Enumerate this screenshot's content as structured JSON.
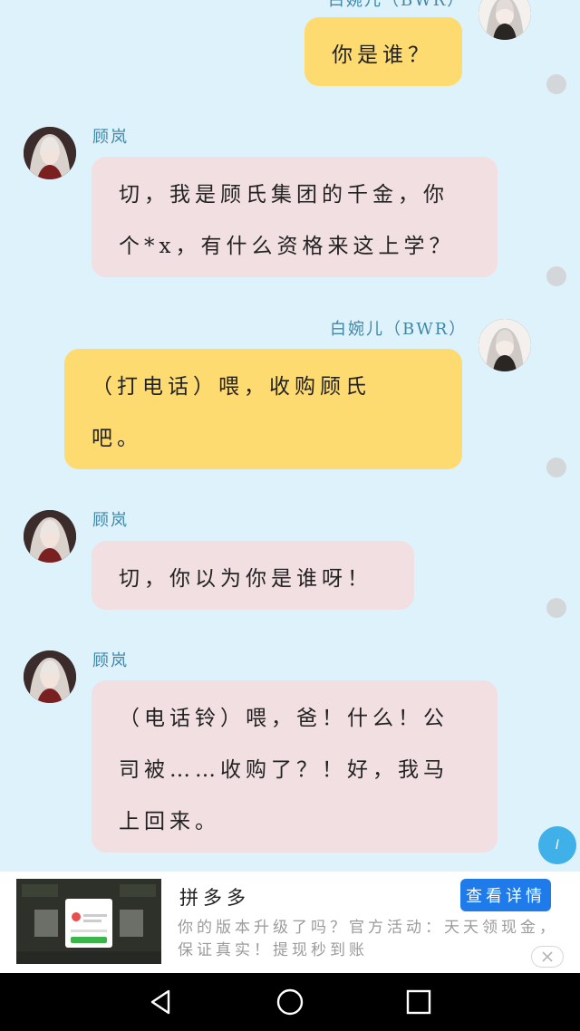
{
  "messages": [
    {
      "side": "right",
      "name": "白婉儿（BWR）",
      "text": "你是谁？"
    },
    {
      "side": "left",
      "name": "顾岚",
      "text": "切，我是顾氏集团的千金，你个*x，有什么资格来这上学？"
    },
    {
      "side": "right",
      "name": "白婉儿（BWR）",
      "text": "（打电话）喂，收购顾氏吧。"
    },
    {
      "side": "left",
      "name": "顾岚",
      "text": "切，你以为你是谁呀！"
    },
    {
      "side": "left",
      "name": "顾岚",
      "text": "（电话铃）喂，爸！什么！公司被……收购了？！好，我马上回来。"
    }
  ],
  "scroll_button": {
    "label": "I"
  },
  "ad": {
    "title": "拼多多",
    "description": "你的版本升级了吗？官方活动：天天领现金，保证真实！提现秒到账",
    "button": "查看详情",
    "close_icon": "close-icon"
  },
  "navbar": {
    "icons": [
      "back-icon",
      "home-icon",
      "recents-icon"
    ]
  },
  "colors": {
    "background": "#def2fb",
    "right_bubble": "#fedb70",
    "left_bubble": "#f2dfe1",
    "name": "#3f87a8",
    "accent": "#1f7be9"
  }
}
